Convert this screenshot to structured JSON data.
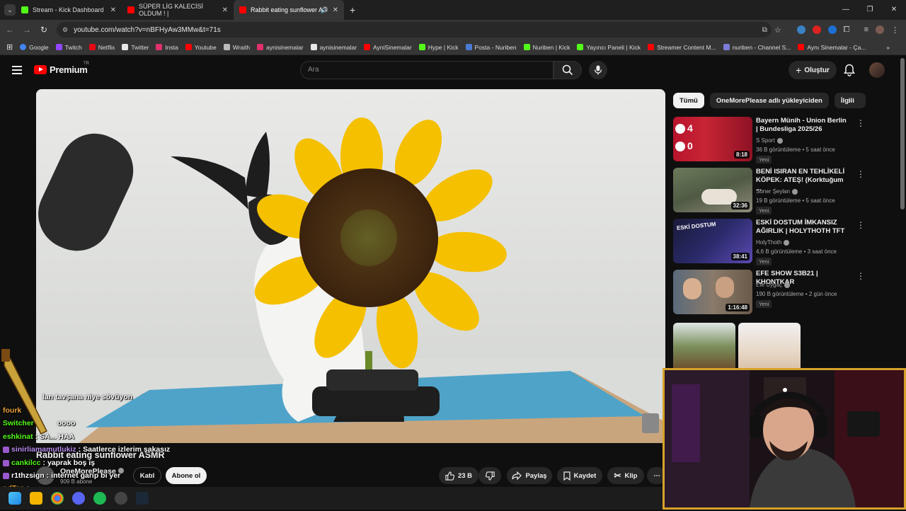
{
  "browser": {
    "tabs": [
      {
        "title": "Stream - Kick Dashboard",
        "favicon_color": "#53fc18"
      },
      {
        "title": "SÜPER LİG KALECİSİ OLDUM ! |",
        "favicon_color": "#ff0000"
      },
      {
        "title": "Rabbit eating sunflower AS",
        "favicon_color": "#ff0000",
        "active": true
      }
    ],
    "url": "youtube.com/watch?v=nBFHyAw3MMw&t=71s",
    "bookmarks": [
      {
        "label": "Google",
        "color": "#4285f4"
      },
      {
        "label": "Twitch",
        "color": "#9146ff"
      },
      {
        "label": "Netflix",
        "color": "#e50914"
      },
      {
        "label": "Twitter",
        "color": "#e7e7e7"
      },
      {
        "label": "Insta",
        "color": "#e1306c"
      },
      {
        "label": "Youtube",
        "color": "#ff0000"
      },
      {
        "label": "Wraith",
        "color": "#bbbbbb"
      },
      {
        "label": "aynisinemalar",
        "color": "#e1306c"
      },
      {
        "label": "aynisinemalar",
        "color": "#e7e7e7"
      },
      {
        "label": "AyniSinemalar",
        "color": "#ff0000"
      },
      {
        "label": "Hype | Kick",
        "color": "#53fc18"
      },
      {
        "label": "Posta - Nuriben",
        "color": "#4a7bd4"
      },
      {
        "label": "Nuriben | Kick",
        "color": "#53fc18"
      },
      {
        "label": "Yayıncı Paneli | Kick",
        "color": "#53fc18"
      },
      {
        "label": "Streamer Content M...",
        "color": "#ff0000"
      },
      {
        "label": "nuriben - Channel S...",
        "color": "#7c7cd8"
      },
      {
        "label": "Aynı Sinemalar - Ça...",
        "color": "#ff0000"
      }
    ]
  },
  "youtube": {
    "logo_text": "Premium",
    "logo_region": "TR",
    "search_placeholder": "Ara",
    "create_label": "Oluştur",
    "video": {
      "title": "Rabbit eating sunflower ASMR",
      "channel": "OneMorePlease",
      "subscribers": "909 B abone",
      "join_label": "Katıl",
      "subscribe_label": "Abone ol",
      "likes": "23 B",
      "share_label": "Paylaş",
      "save_label": "Kaydet",
      "clip_label": "Klip"
    },
    "chips": [
      "Tümü",
      "OneMorePlease adlı yükleyiciden",
      "İlgili"
    ],
    "recommendations": [
      {
        "title": "Bayern Münih - Union Berlin | Bundesliga 2025/26",
        "channel": "S Sport",
        "meta": "36 B görüntüleme • 5 saat önce",
        "badge": "Yeni",
        "duration": "8:18",
        "score_top": "4",
        "score_bottom": "0"
      },
      {
        "title": "BENİ ISIRAN EN TEHLİKELİ KÖPEK: ATEŞ! (Korktuğum ...",
        "channel": "Soner Şeylan",
        "meta": "19 B görüntüleme • 5 saat önce",
        "badge": "Yeni",
        "duration": "32:36"
      },
      {
        "title": "ESKİ DOSTUM İMKANSIZ AĞIRLIK | HOLYTHOTH TFT",
        "channel": "HolyThoth",
        "meta": "4,6 B görüntüleme • 3 saat önce",
        "badge": "Yeni",
        "duration": "38:41",
        "thumb_text": "ESKİ DOSTUM"
      },
      {
        "title": "EFE SHOW S3B21 | KHONTKAR",
        "channel": "Efe Uygaç",
        "meta": "190 B görüntüleme • 2 gün önce",
        "badge": "Yeni",
        "duration": "1:16:48"
      }
    ]
  },
  "stream_overlay": {
    "chat": [
      {
        "user": "",
        "msg": "lan tavşana niye sövüyon",
        "color": "#ffffff"
      },
      {
        "user": "fourk",
        "msg": "",
        "color": "#e8a23a"
      },
      {
        "user": "Switcher",
        "msg": "oooo",
        "color": "#53fc18"
      },
      {
        "user": "eshkinat",
        "msg": "SA... HAA",
        "color": "#53fc18"
      },
      {
        "user": "sinirliamamutlukiz",
        "msg": "Saatlerce izlerim şakasız",
        "color": "#b98cf0"
      },
      {
        "user": "cankilcc",
        "msg": "yaprak boş iş",
        "color": "#53fc18"
      },
      {
        "user": "r1thzsign",
        "msg": "internet garip bi yer",
        "color": "#ffffff"
      },
      {
        "user": "ndTap",
        "msg": "",
        "color": "#e8a23a"
      }
    ]
  }
}
